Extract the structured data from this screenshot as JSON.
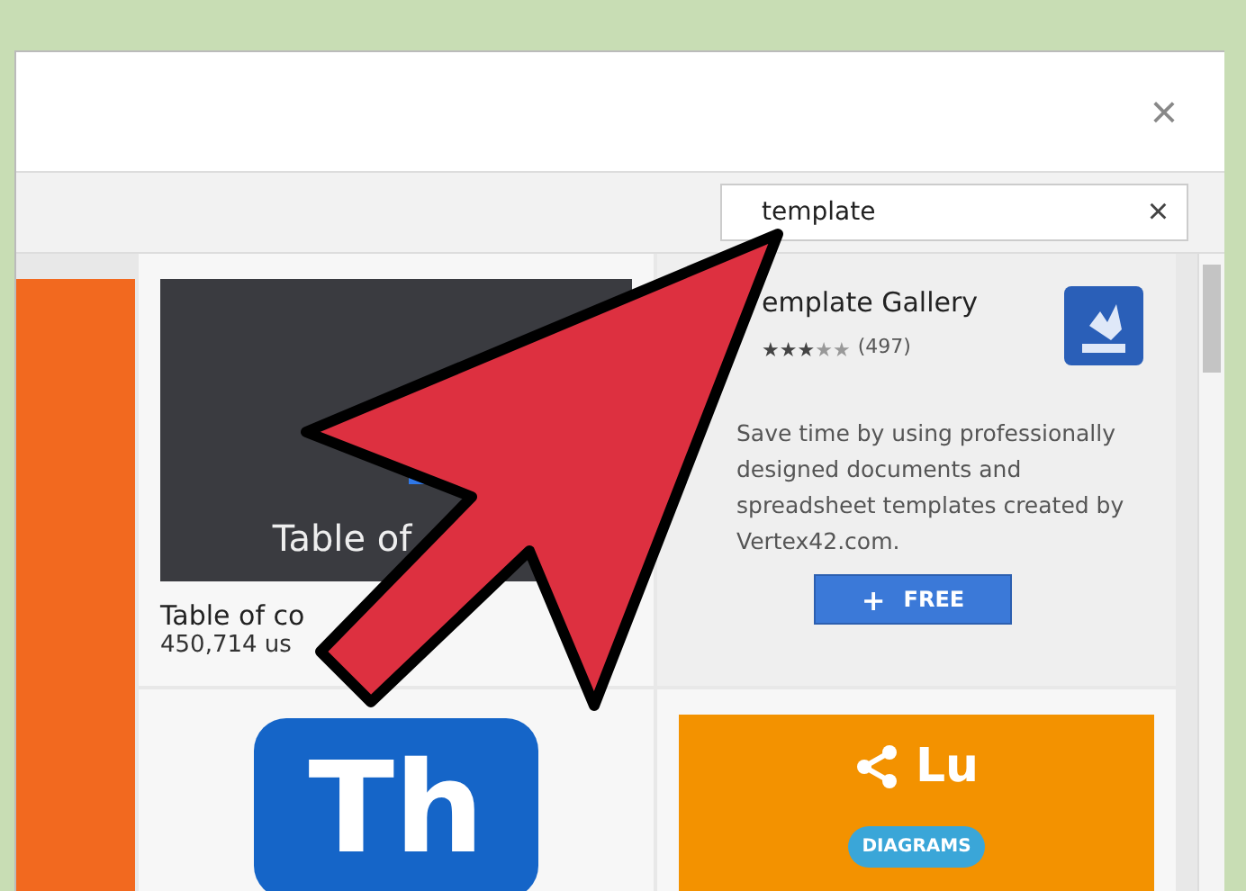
{
  "dialog": {
    "close": "×"
  },
  "search": {
    "value": "template",
    "clear": "×"
  },
  "cards": [
    {
      "kind": "thumb",
      "image_text": "Table of",
      "title": "Table of co",
      "users": "450,714 us"
    },
    {
      "kind": "detail",
      "title": "emplate Gallery",
      "stars": 3,
      "count": "(497)",
      "description": "Save time by using professionally designed documents and spreadsheet templates created by Vertex42.com.",
      "button": {
        "icon": "+",
        "label": "FREE"
      }
    },
    {
      "kind": "logo",
      "logo_text": "Th"
    },
    {
      "kind": "promo",
      "logo_text": "Lu",
      "badge": "DIAGRAMS"
    }
  ]
}
